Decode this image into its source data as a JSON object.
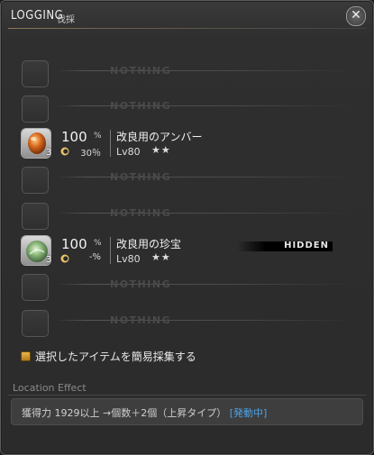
{
  "window": {
    "title": "LOGGING",
    "subtitle": "伐採",
    "close_glyph": "✕"
  },
  "slots": [
    {
      "type": "empty",
      "label": "NOTHING"
    },
    {
      "type": "empty",
      "label": "NOTHING"
    },
    {
      "type": "item",
      "name": "改良用のアンバー",
      "success_rate": "100",
      "percent_sign": "%",
      "hq_rate": "30％",
      "level": "Lv80",
      "stars": "★★",
      "count": "3",
      "color": "#c8661e",
      "hidden": false
    },
    {
      "type": "empty",
      "label": "NOTHING"
    },
    {
      "type": "empty",
      "label": "NOTHING"
    },
    {
      "type": "item",
      "name": "改良用の珍宝",
      "success_rate": "100",
      "percent_sign": "%",
      "hq_rate": "-%",
      "level": "Lv80",
      "stars": "★★",
      "count": "3",
      "color": "#6a9a5a",
      "hidden": true,
      "hidden_label": "HIDDEN"
    },
    {
      "type": "empty",
      "label": "NOTHING"
    },
    {
      "type": "empty",
      "label": "NOTHING"
    }
  ],
  "quick_gather": {
    "label": "選択したアイテムを簡易採集する"
  },
  "location_effect": {
    "title": "Location Effect",
    "text": "獲得力 1929以上 →個数＋2個（上昇タイプ）",
    "status": "[発動中]"
  }
}
